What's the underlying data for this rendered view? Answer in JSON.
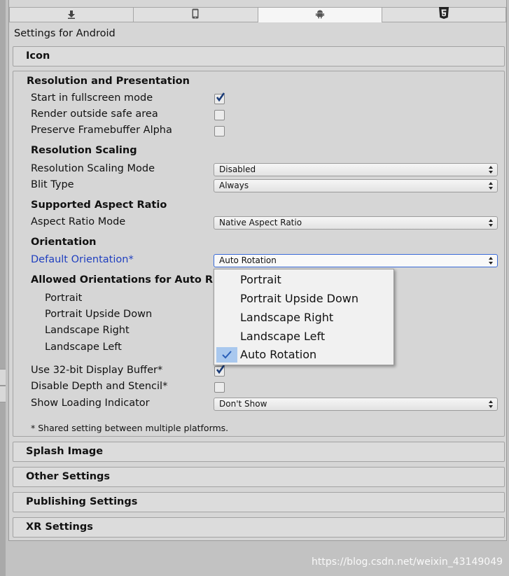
{
  "tabs": [
    {
      "icon": "download-icon",
      "name": "standalone"
    },
    {
      "icon": "phone-icon",
      "name": "ios"
    },
    {
      "icon": "android-icon",
      "name": "android",
      "active": true
    },
    {
      "icon": "html5-icon",
      "name": "webgl"
    }
  ],
  "header": {
    "title": "Settings for Android"
  },
  "sections": {
    "icon": "Icon",
    "splash": "Splash Image",
    "other": "Other Settings",
    "publishing": "Publishing Settings",
    "xr": "XR Settings"
  },
  "resolution": {
    "title": "Resolution and Presentation",
    "fullscreen": {
      "label": "Start in fullscreen mode",
      "checked": true
    },
    "safe_area": {
      "label": "Render outside safe area",
      "checked": false
    },
    "framebuffer_alpha": {
      "label": "Preserve Framebuffer Alpha",
      "checked": false
    },
    "scaling_title": "Resolution Scaling",
    "scaling_mode": {
      "label": "Resolution Scaling Mode",
      "value": "Disabled"
    },
    "blit_type": {
      "label": "Blit Type",
      "value": "Always"
    },
    "aspect_title": "Supported Aspect Ratio",
    "aspect_mode": {
      "label": "Aspect Ratio Mode",
      "value": "Native Aspect Ratio"
    },
    "orientation_title": "Orientation",
    "default_orientation": {
      "label": "Default Orientation*",
      "value": "Auto Rotation"
    },
    "allowed_title": "Allowed Orientations for Auto R",
    "allowed": [
      "Portrait",
      "Portrait Upside Down",
      "Landscape Right",
      "Landscape Left"
    ],
    "buffer32": {
      "label": "Use 32-bit Display Buffer*",
      "checked": true
    },
    "depth_stencil": {
      "label": "Disable Depth and Stencil*",
      "checked": false
    },
    "loading_indicator": {
      "label": "Show Loading Indicator",
      "value": "Don't Show"
    },
    "footnote": "* Shared setting between multiple platforms."
  },
  "orientation_popup": {
    "options": [
      "Portrait",
      "Portrait Upside Down",
      "Landscape Right",
      "Landscape Left",
      "Auto Rotation"
    ],
    "selected": "Auto Rotation"
  },
  "watermark": "https://blog.csdn.net/weixin_43149049",
  "colors": {
    "accent": "#3a6bd8",
    "link_label": "#1f3fbf",
    "selection": "#a9c8ee"
  }
}
